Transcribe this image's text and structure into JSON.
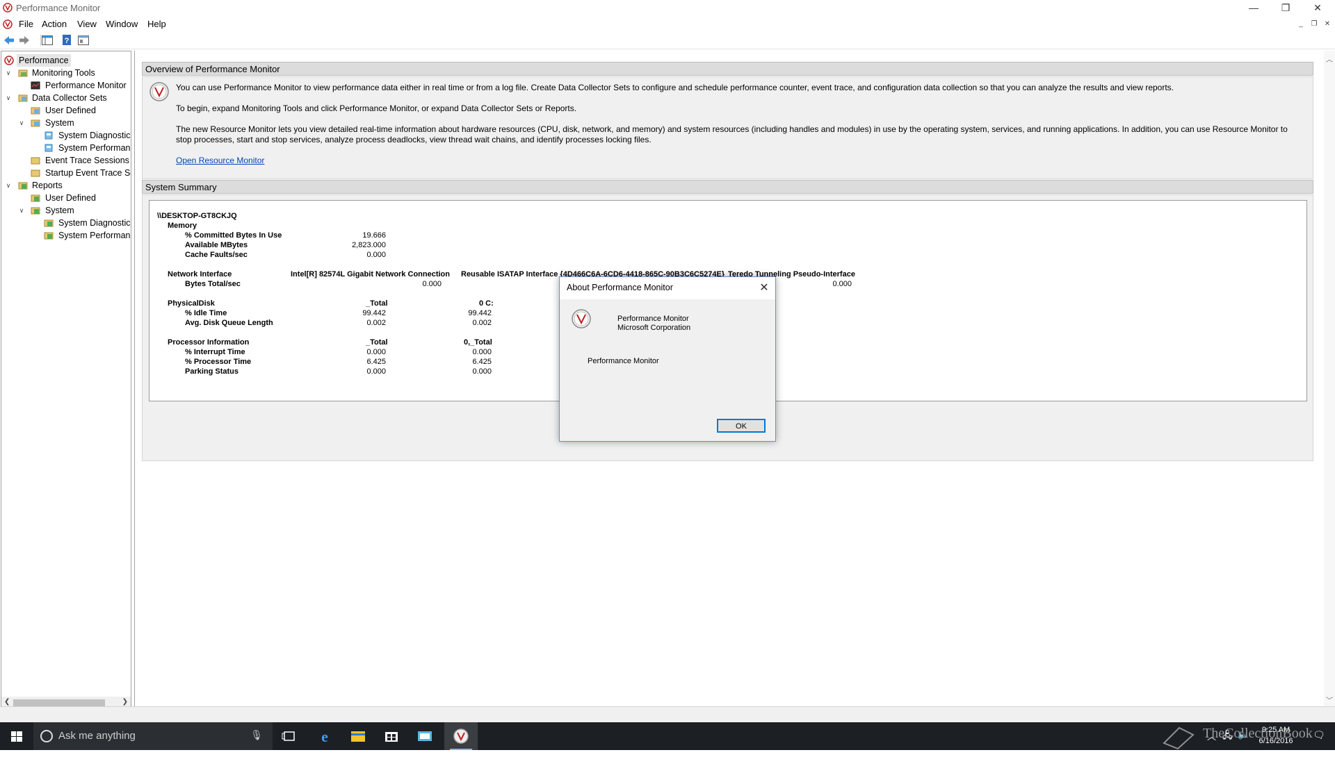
{
  "window": {
    "title": "Performance Monitor",
    "controls": {
      "minimize": "—",
      "restore": "❐",
      "close": "✕"
    }
  },
  "menu": {
    "items": [
      "File",
      "Action",
      "View",
      "Window",
      "Help"
    ]
  },
  "toolbar": {
    "icons": [
      "back-icon",
      "forward-icon",
      "show-hide-tree-icon",
      "help-icon",
      "properties-icon"
    ]
  },
  "tree": {
    "items": [
      {
        "label": "Performance"
      },
      {
        "label": "Monitoring Tools"
      },
      {
        "label": "Performance Monitor"
      },
      {
        "label": "Data Collector Sets"
      },
      {
        "label": "User Defined"
      },
      {
        "label": "System"
      },
      {
        "label": "System Diagnostics"
      },
      {
        "label": "System Performanc"
      },
      {
        "label": "Event Trace Sessions"
      },
      {
        "label": "Startup Event Trace Ses"
      },
      {
        "label": "Reports"
      },
      {
        "label": "User Defined"
      },
      {
        "label": "System"
      },
      {
        "label": "System Diagnostics"
      },
      {
        "label": "System Performanc"
      }
    ]
  },
  "overview": {
    "header": "Overview of Performance Monitor",
    "p1": "You can use Performance Monitor to view performance data either in real time or from a log file. Create Data Collector Sets to configure and schedule performance counter, event trace, and configuration data collection so that you can analyze the results and view reports.",
    "p2": "To begin, expand Monitoring Tools and click Performance Monitor, or expand Data Collector Sets or Reports.",
    "p3": "The new Resource Monitor lets you view detailed real-time information about hardware resources (CPU, disk, network, and memory) and system resources (including handles and modules) in use by the operating system, services, and running applications. In addition, you can use Resource Monitor to stop processes, start and stop services, analyze process deadlocks, view thread wait chains, and identify processes locking files.",
    "link": "Open Resource Monitor"
  },
  "summary": {
    "header": "System Summary",
    "host": "\\\\DESKTOP-GT8CKJQ",
    "memory": {
      "label": "Memory",
      "rows": [
        {
          "name": "% Committed Bytes In Use",
          "value": "19.666"
        },
        {
          "name": "Available MBytes",
          "value": "2,823.000"
        },
        {
          "name": "Cache Faults/sec",
          "value": "0.000"
        }
      ]
    },
    "network": {
      "label": "Network Interface",
      "col1": "Intel[R] 82574L Gigabit Network Connection",
      "col2": "Reusable ISATAP Interface {4D466C6A-6CD6-4418-865C-90B3C6C5274E}",
      "col3": "Teredo Tunneling Pseudo-Interface",
      "row_name": "Bytes Total/sec",
      "v1": "0.000",
      "v3": "0.000"
    },
    "disk": {
      "label": "PhysicalDisk",
      "col1": "_Total",
      "col2": "0 C:",
      "rows": [
        {
          "name": "% Idle Time",
          "v1": "99.442",
          "v2": "99.442"
        },
        {
          "name": "Avg. Disk Queue Length",
          "v1": "0.002",
          "v2": "0.002"
        }
      ]
    },
    "processor": {
      "label": "Processor Information",
      "col1": "_Total",
      "col2": "0,_Total",
      "rows": [
        {
          "name": "% Interrupt Time",
          "v1": "0.000",
          "v2": "0.000"
        },
        {
          "name": "% Processor Time",
          "v1": "6.425",
          "v2": "6.425"
        },
        {
          "name": "Parking Status",
          "v1": "0.000",
          "v2": "0.000"
        }
      ]
    }
  },
  "dialog": {
    "title": "About Performance Monitor",
    "product": "Performance Monitor",
    "company": "Microsoft Corporation",
    "description": "Performance Monitor",
    "ok": "OK"
  },
  "taskbar": {
    "search_placeholder": "Ask me anything",
    "time": "9:25 AM",
    "date": "6/16/2016",
    "watermark": "TheCollectionBook"
  }
}
